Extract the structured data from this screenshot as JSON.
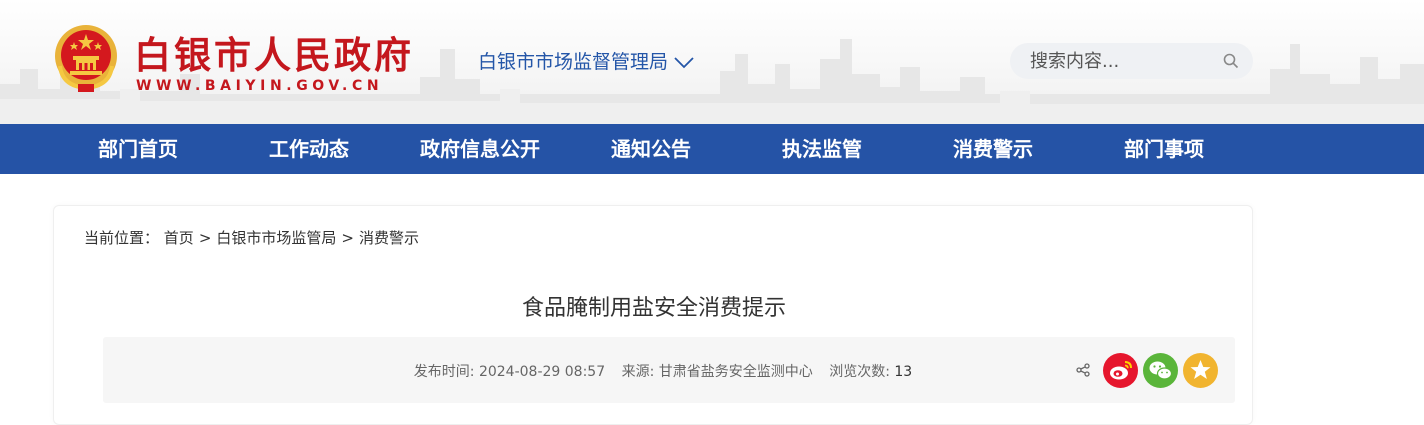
{
  "header": {
    "site_name": "白银市人民政府",
    "site_domain": "WWW.BAIYIN.GOV.CN",
    "department": "白银市市场监督管理局",
    "search_placeholder": "搜索内容..."
  },
  "nav": {
    "items": [
      {
        "label": "部门首页"
      },
      {
        "label": "工作动态"
      },
      {
        "label": "政府信息公开"
      },
      {
        "label": "通知公告"
      },
      {
        "label": "执法监管"
      },
      {
        "label": "消费警示"
      },
      {
        "label": "部门事项"
      }
    ]
  },
  "breadcrumb": {
    "prefix": "当前位置：",
    "home": "首页",
    "dept": "白银市市场监管局",
    "current": "消费警示",
    "separator": ">"
  },
  "article": {
    "title": "食品腌制用盐安全消费提示",
    "publish_label": "发布时间:",
    "publish_time": "2024-08-29 08:57",
    "source_label": "来源:",
    "source": "甘肃省盐务安全监测中心",
    "views_label": "浏览次数:",
    "views": "13"
  },
  "colors": {
    "brand_red": "#c4171d",
    "nav_blue": "#2553a6",
    "weibo": "#e6162d",
    "wechat": "#5ab53a",
    "favorite": "#f1b42f"
  },
  "icons": [
    "national-emblem-icon",
    "chevron-down-icon",
    "search-icon",
    "share-icon",
    "weibo-icon",
    "wechat-icon",
    "favorite-star-icon"
  ]
}
